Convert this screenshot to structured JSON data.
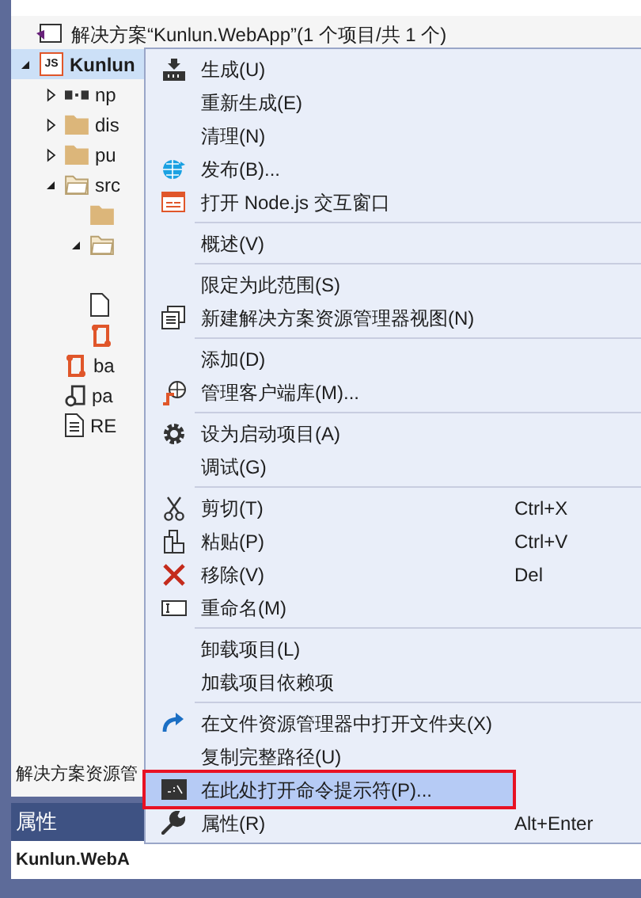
{
  "solution": {
    "label": "解决方案“Kunlun.WebApp”(1 个项目/共 1 个)"
  },
  "tree": [
    {
      "label": "Kunlun",
      "kind": "js",
      "badge": "JS",
      "expanded": true,
      "selected": true,
      "children": [
        {
          "label": "np",
          "kind": "npm",
          "expanded": false
        },
        {
          "label": "dis",
          "kind": "folder",
          "expanded": false
        },
        {
          "label": "pu",
          "kind": "folder",
          "expanded": false
        },
        {
          "label": "src",
          "kind": "folder-open",
          "expanded": true,
          "children": [
            {
              "kind": "folder"
            },
            {
              "kind": "folder-open",
              "expanded": true
            },
            {
              "kind": "file"
            },
            {
              "kind": "config"
            }
          ]
        },
        {
          "label": "ba",
          "kind": "config"
        },
        {
          "label": "pa",
          "kind": "package"
        },
        {
          "label": "RE",
          "kind": "readme"
        }
      ]
    }
  ],
  "explorer_tab": {
    "label": "解决方案资源管"
  },
  "properties": {
    "title": "属性",
    "object": "Kunlun.WebA"
  },
  "menu": [
    {
      "kind": "build",
      "label": "生成(U)",
      "selected": false
    },
    {
      "kind": "plain",
      "label": "重新生成(E)",
      "selected": false
    },
    {
      "kind": "plain",
      "label": "清理(N)",
      "selected": false
    },
    {
      "kind": "globe",
      "label": "发布(B)...",
      "selected": false
    },
    {
      "kind": "console",
      "label": "打开 Node.js 交互窗口",
      "selected": false
    },
    {
      "kind": "separator"
    },
    {
      "kind": "plain",
      "label": "概述(V)",
      "selected": false
    },
    {
      "kind": "separator"
    },
    {
      "kind": "plain",
      "label": "限定为此范围(S)",
      "selected": false
    },
    {
      "kind": "windows",
      "label": "新建解决方案资源管理器视图(N)",
      "selected": false
    },
    {
      "kind": "separator"
    },
    {
      "kind": "plain",
      "label": "添加(D)",
      "selected": false
    },
    {
      "kind": "library",
      "label": "管理客户端库(M)...",
      "selected": false
    },
    {
      "kind": "separator"
    },
    {
      "kind": "gear",
      "label": "设为启动项目(A)",
      "selected": false
    },
    {
      "kind": "plain",
      "label": "调试(G)",
      "selected": false
    },
    {
      "kind": "separator"
    },
    {
      "kind": "cut",
      "label": "剪切(T)",
      "shortcut": "Ctrl+X",
      "selected": false
    },
    {
      "kind": "paste",
      "label": "粘贴(P)",
      "shortcut": "Ctrl+V",
      "selected": false
    },
    {
      "kind": "delete",
      "label": "移除(V)",
      "shortcut": "Del",
      "selected": false
    },
    {
      "kind": "rename",
      "label": "重命名(M)",
      "selected": false
    },
    {
      "kind": "separator"
    },
    {
      "kind": "plain",
      "label": "卸载项目(L)",
      "selected": false
    },
    {
      "kind": "plain",
      "label": "加载项目依赖项",
      "selected": false
    },
    {
      "kind": "separator"
    },
    {
      "kind": "redo",
      "label": "在文件资源管理器中打开文件夹(X)",
      "selected": false
    },
    {
      "kind": "plain",
      "label": "复制完整路径(U)",
      "selected": false
    },
    {
      "kind": "cmd",
      "label": "在此处打开命令提示符(P)...",
      "selected": true
    },
    {
      "kind": "wrench",
      "label": "属性(R)",
      "shortcut": "Alt+Enter",
      "selected": false
    }
  ]
}
